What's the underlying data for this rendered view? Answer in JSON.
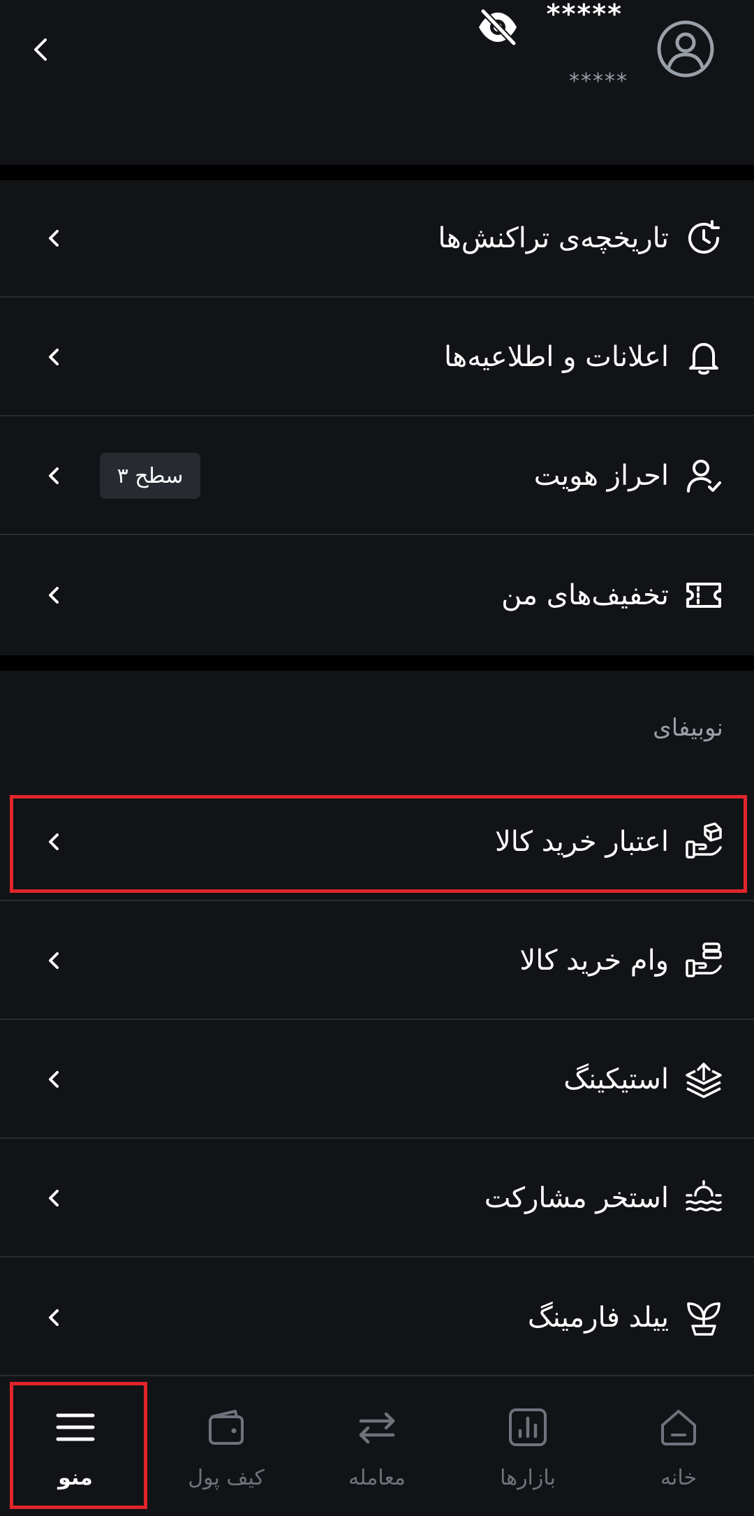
{
  "header": {
    "username": "*****",
    "subline": "*****"
  },
  "account_section": {
    "items": [
      {
        "label": "تاریخچه‌ی تراکنش‌ها",
        "icon": "history-icon"
      },
      {
        "label": "اعلانات و اطلاعیه‌ها",
        "icon": "bell-icon"
      },
      {
        "label": "احراز هویت",
        "icon": "user-check-icon",
        "badge": "سطح ۳"
      },
      {
        "label": "تخفیف‌های من",
        "icon": "ticket-icon"
      }
    ]
  },
  "nobifi_section": {
    "title": "نوبیفای",
    "items": [
      {
        "label": "اعتبار خرید کالا",
        "icon": "hand-box-icon"
      },
      {
        "label": "وام خرید کالا",
        "icon": "hand-coins-icon"
      },
      {
        "label": "استیکینگ",
        "icon": "layers-up-icon"
      },
      {
        "label": "استخر مشارکت",
        "icon": "pool-icon"
      },
      {
        "label": "ییلد فارمینگ",
        "icon": "sprout-icon"
      }
    ]
  },
  "bottom_nav": {
    "items": [
      {
        "label": "منو",
        "icon": "menu-icon",
        "active": true
      },
      {
        "label": "کیف پول",
        "icon": "wallet-icon",
        "active": false
      },
      {
        "label": "معامله",
        "icon": "swap-icon",
        "active": false
      },
      {
        "label": "بازارها",
        "icon": "markets-icon",
        "active": false
      },
      {
        "label": "خانه",
        "icon": "home-icon",
        "active": false
      }
    ]
  },
  "colors": {
    "background": "#000000",
    "surface": "#121316",
    "divider": "#2a2c31",
    "muted_text": "#9aa0a8",
    "nav_inactive": "#6e737c",
    "highlight": "#e0252b"
  }
}
